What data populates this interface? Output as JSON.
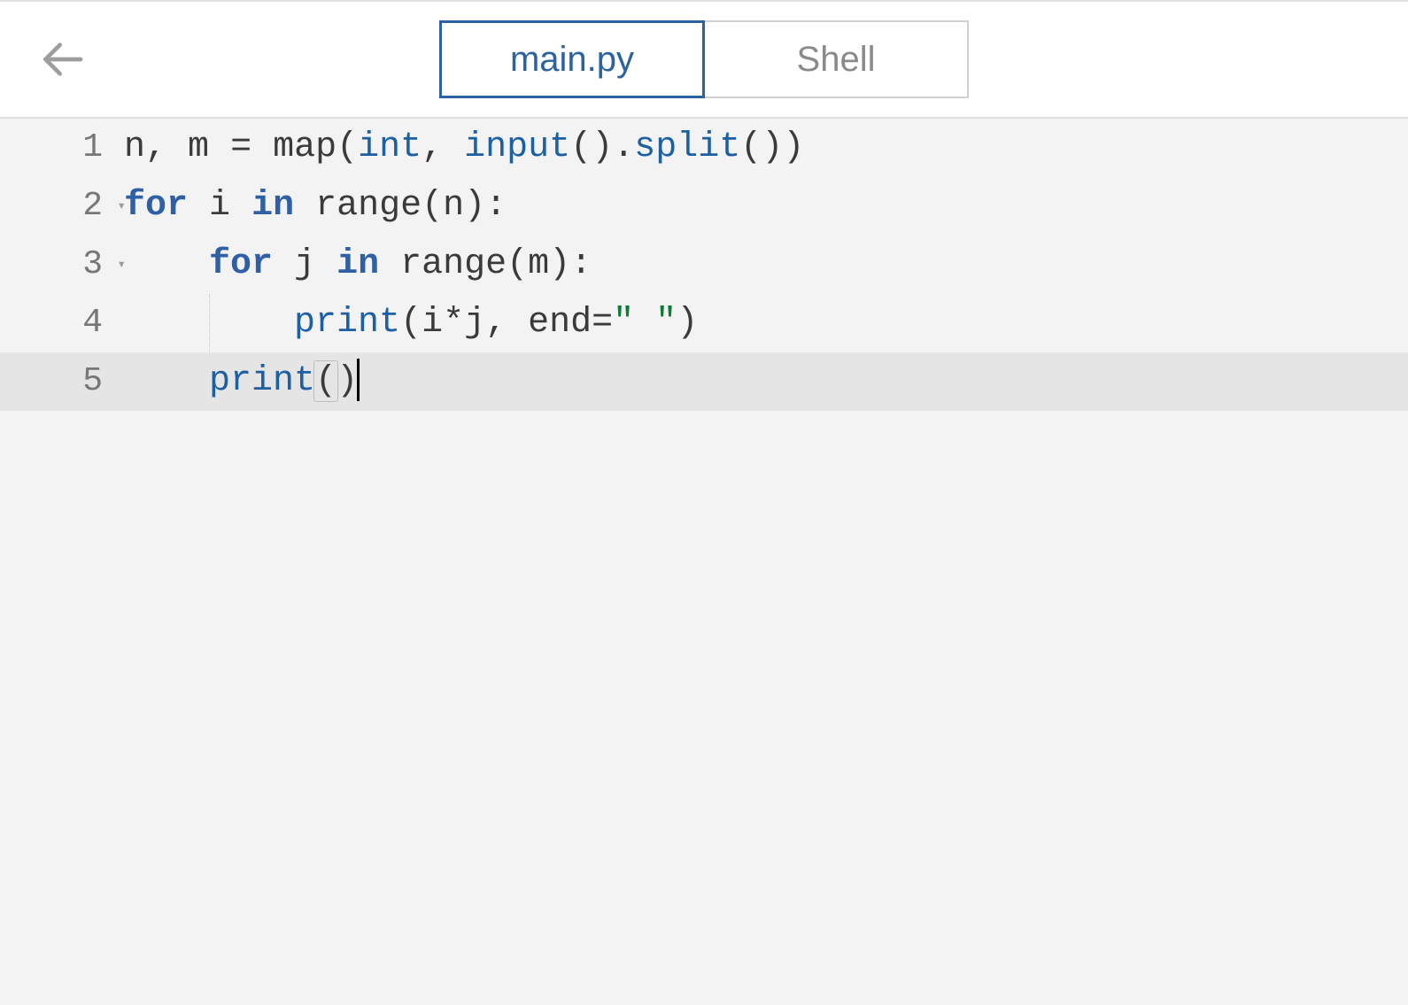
{
  "header": {
    "tabs": {
      "main": "main.py",
      "shell": "Shell"
    },
    "active_tab": "main"
  },
  "editor": {
    "active_line": 5,
    "lines": [
      {
        "num": "1",
        "foldable": false,
        "tokens": [
          {
            "t": "n",
            "c": "id"
          },
          {
            "t": ", ",
            "c": "pn"
          },
          {
            "t": "m",
            "c": "id"
          },
          {
            "t": " ",
            "c": "pn"
          },
          {
            "t": "=",
            "c": "op"
          },
          {
            "t": " ",
            "c": "pn"
          },
          {
            "t": "map",
            "c": "bi"
          },
          {
            "t": "(",
            "c": "pn"
          },
          {
            "t": "int",
            "c": "fn"
          },
          {
            "t": ", ",
            "c": "pn"
          },
          {
            "t": "input",
            "c": "fn"
          },
          {
            "t": "()",
            "c": "pn"
          },
          {
            "t": ".",
            "c": "pn"
          },
          {
            "t": "split",
            "c": "fn"
          },
          {
            "t": "())",
            "c": "pn"
          }
        ]
      },
      {
        "num": "2",
        "foldable": true,
        "tokens": [
          {
            "t": "for",
            "c": "kw"
          },
          {
            "t": " ",
            "c": "pn"
          },
          {
            "t": "i",
            "c": "id"
          },
          {
            "t": " ",
            "c": "pn"
          },
          {
            "t": "in",
            "c": "kw"
          },
          {
            "t": " ",
            "c": "pn"
          },
          {
            "t": "range",
            "c": "bi"
          },
          {
            "t": "(",
            "c": "pn"
          },
          {
            "t": "n",
            "c": "id"
          },
          {
            "t": ")",
            "c": "pn"
          },
          {
            "t": ":",
            "c": "pn"
          }
        ]
      },
      {
        "num": "3",
        "foldable": true,
        "indent": 1,
        "tokens": [
          {
            "t": "for",
            "c": "kw"
          },
          {
            "t": " ",
            "c": "pn"
          },
          {
            "t": "j",
            "c": "id"
          },
          {
            "t": " ",
            "c": "pn"
          },
          {
            "t": "in",
            "c": "kw"
          },
          {
            "t": " ",
            "c": "pn"
          },
          {
            "t": "range",
            "c": "bi"
          },
          {
            "t": "(",
            "c": "pn"
          },
          {
            "t": "m",
            "c": "id"
          },
          {
            "t": ")",
            "c": "pn"
          },
          {
            "t": ":",
            "c": "pn"
          }
        ]
      },
      {
        "num": "4",
        "foldable": false,
        "indent": 2,
        "guide": true,
        "tokens": [
          {
            "t": "print",
            "c": "fn"
          },
          {
            "t": "(",
            "c": "pn"
          },
          {
            "t": "i",
            "c": "id"
          },
          {
            "t": "*",
            "c": "op"
          },
          {
            "t": "j",
            "c": "id"
          },
          {
            "t": ", ",
            "c": "pn"
          },
          {
            "t": "end",
            "c": "id"
          },
          {
            "t": "=",
            "c": "op"
          },
          {
            "t": "\" \"",
            "c": "str"
          },
          {
            "t": ")",
            "c": "pn"
          }
        ]
      },
      {
        "num": "5",
        "foldable": false,
        "indent": 1,
        "cursor": true,
        "tokens": [
          {
            "t": "print",
            "c": "fn"
          },
          {
            "t": "(",
            "c": "pn",
            "hl": true
          },
          {
            "t": ")",
            "c": "pn"
          }
        ]
      }
    ]
  }
}
